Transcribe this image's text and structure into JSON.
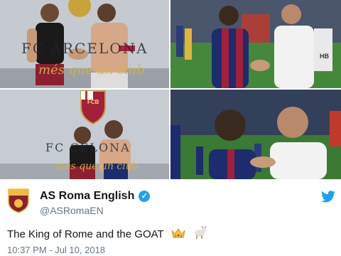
{
  "photos": [
    {
      "alt": "Two players shaking hands in the dressing room",
      "wall_text": "FC ARCELONA",
      "wall_script": "més que un club"
    },
    {
      "alt": "Players greeting on the pitch",
      "badge_text": "HB"
    },
    {
      "alt": "Two players posing in the dressing room",
      "wall_text": "FC CELONA",
      "wall_script": "més que un club",
      "crest_text": "FCB"
    },
    {
      "alt": "Two players embracing on the pitch"
    }
  ],
  "tweet": {
    "display_name": "AS Roma English",
    "handle": "@ASRomaEN",
    "text": "The King of Rome and the GOAT",
    "emojis": [
      "crown-icon",
      "goat-icon"
    ],
    "timestamp": "10:37 PM - Jul 10, 2018",
    "verified": true
  },
  "colors": {
    "twitter_blue": "#1da1f2",
    "roma_red": "#8e1f2f",
    "roma_gold": "#f0bc42",
    "secondary_text": "#657786"
  }
}
